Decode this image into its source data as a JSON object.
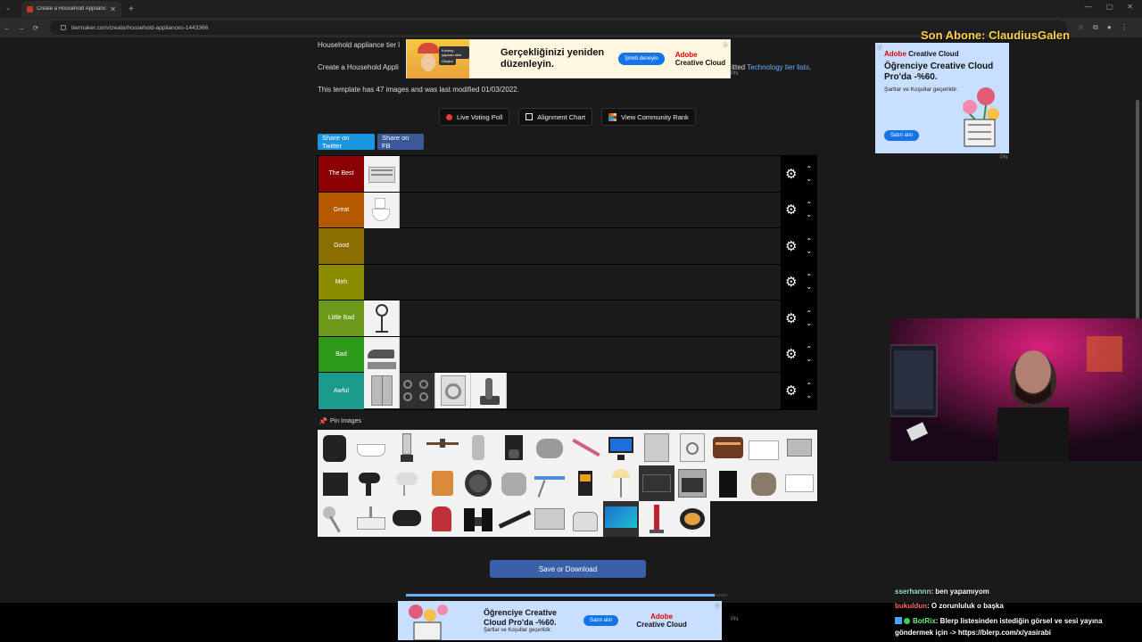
{
  "browser": {
    "tab_title": "Create a Household Appliance",
    "url": "tiermaker.com/create/household-appliances-1443366"
  },
  "page": {
    "intro_line1": "Household appliance tier l",
    "intro_line2_start": "Create a Household Appli",
    "intro_line2_end": "itted",
    "intro_link": "Technology tier lists",
    "intro_line2_tail": ".",
    "template_info": "This template has 47 images and was last modified 01/03/2022.",
    "buttons": {
      "live_poll": "Live Voting Poll",
      "alignment": "Alignment Chart",
      "community": "View Community Rank"
    },
    "share": {
      "twitter": "Share on Twitter",
      "facebook": "Share on FB"
    },
    "tiers": [
      {
        "label": "The Best",
        "color": "#8b0000"
      },
      {
        "label": "Great",
        "color": "#b35900"
      },
      {
        "label": "Good",
        "color": "#8a6d00"
      },
      {
        "label": "Meh",
        "color": "#8b8b00"
      },
      {
        "label": "Little Bad",
        "color": "#6b9a1a"
      },
      {
        "label": "Bad",
        "color": "#2e9a1a"
      },
      {
        "label": "Awful",
        "color": "#1a9a8a"
      }
    ],
    "pin_label": "Pin Images",
    "save_button": "Save or Download"
  },
  "ads": {
    "top": {
      "headline": "Gerçekliğinizi yeniden düzenleyin.",
      "cta": "Şimdi deneyin",
      "brand_line1": "Adobe",
      "brand_line2": "Creative Cloud",
      "small_label": "Kovboy şapkası ekle",
      "small_cta": "Oluştur",
      "pn": "PN"
    },
    "right": {
      "brand_red": "Adobe",
      "brand_rest": "Creative Cloud",
      "headline": "Öğrenciye Creative Cloud Pro'da -%60.",
      "sub": "Şartlar ve Koşullar geçerlidir.",
      "cta": "Satın alın",
      "pn": "PN"
    },
    "bottom": {
      "headline": "Öğrenciye Creative Cloud Pro'da -%60.",
      "sub": "Şartlar ve Koşullar geçerlidir.",
      "cta": "Satın alın",
      "brand_line1": "Adobe",
      "brand_line2": "Creative Cloud",
      "pn": "PN"
    }
  },
  "stream": {
    "overlay_title": "Son Abone: ClaudiusGalen",
    "chat": [
      {
        "user": "sserhannn",
        "text": ": ben yapamıyom"
      },
      {
        "user": "bukuldun",
        "text": ": O zorunluluk o başka"
      },
      {
        "user": "BotRix",
        "text": ": Blerp listesinden istediğin görsel ve sesi yayına göndermek için -> https://blerp.com/x/yasirabi"
      }
    ]
  }
}
